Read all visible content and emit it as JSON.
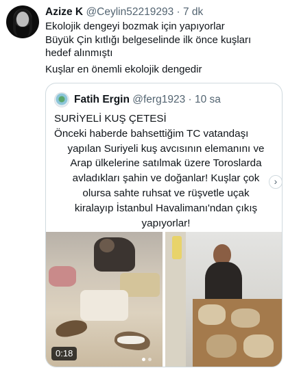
{
  "tweet": {
    "author_name": "Azize K",
    "author_handle": "@Ceylin52219293",
    "time": "· 7 dk",
    "lines": [
      "Ekolojik dengeyi bozmak için  yapıyorlar",
      "Büyük Çin kıtlığı belgeselinde ilk önce kuşları",
      "hedef alınmıştı",
      "Kuşlar en önemli ekolojik dengedir"
    ]
  },
  "quoted_tweet": {
    "author_name": "Fatih Ergin",
    "author_handle": "@ferg1923",
    "time": "· 10 sa",
    "lines": [
      "SURİYELİ KUŞ ÇETESİ",
      "Önceki haberde bahsettiğim TC vatandaşı",
      "yapılan Suriyeli kuş avcısının elemanını ve",
      "Arap ülkelerine satılmak üzere Toroslarda",
      "avladıkları şahin ve doğanlar! Kuşlar çok",
      "olursa sahte ruhsat ve rüşvetle uçak",
      "kiralayıp İstanbul Havalimanı'ndan çıkış",
      "yapıyorlar!"
    ],
    "media": {
      "video_duration": "0:18",
      "carousel_dots": 2,
      "active_dot": 1
    }
  },
  "icons": {
    "next": "chevron-right-icon"
  },
  "colors": {
    "text_primary": "#0f1419",
    "text_secondary": "#536471",
    "border": "#cfd9de"
  }
}
